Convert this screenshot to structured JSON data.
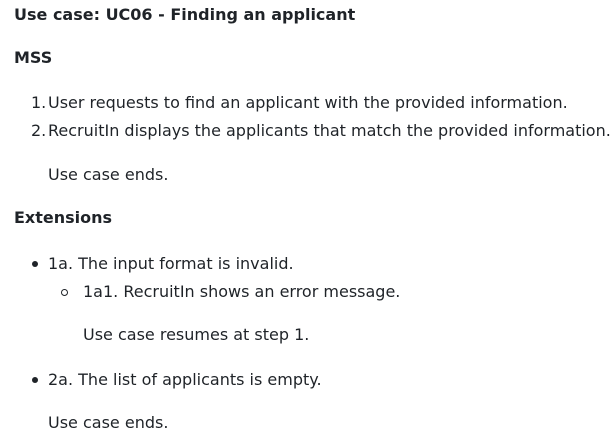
{
  "title": "Use case: UC06 - Finding an applicant",
  "mss": {
    "heading": "MSS",
    "steps": [
      {
        "num": "1.",
        "text": "User requests to find an applicant with the provided information."
      },
      {
        "num": "2.",
        "text": "RecruitIn displays the applicants that match the provided information."
      }
    ],
    "ending": "Use case ends."
  },
  "extensions": {
    "heading": "Extensions",
    "items": [
      {
        "text": "1a. The input format is invalid.",
        "sub": [
          {
            "text": "1a1. RecruitIn shows an error message.",
            "note": "Use case resumes at step 1."
          }
        ]
      },
      {
        "text": "2a. The list of applicants is empty.",
        "note": "Use case ends."
      }
    ]
  }
}
